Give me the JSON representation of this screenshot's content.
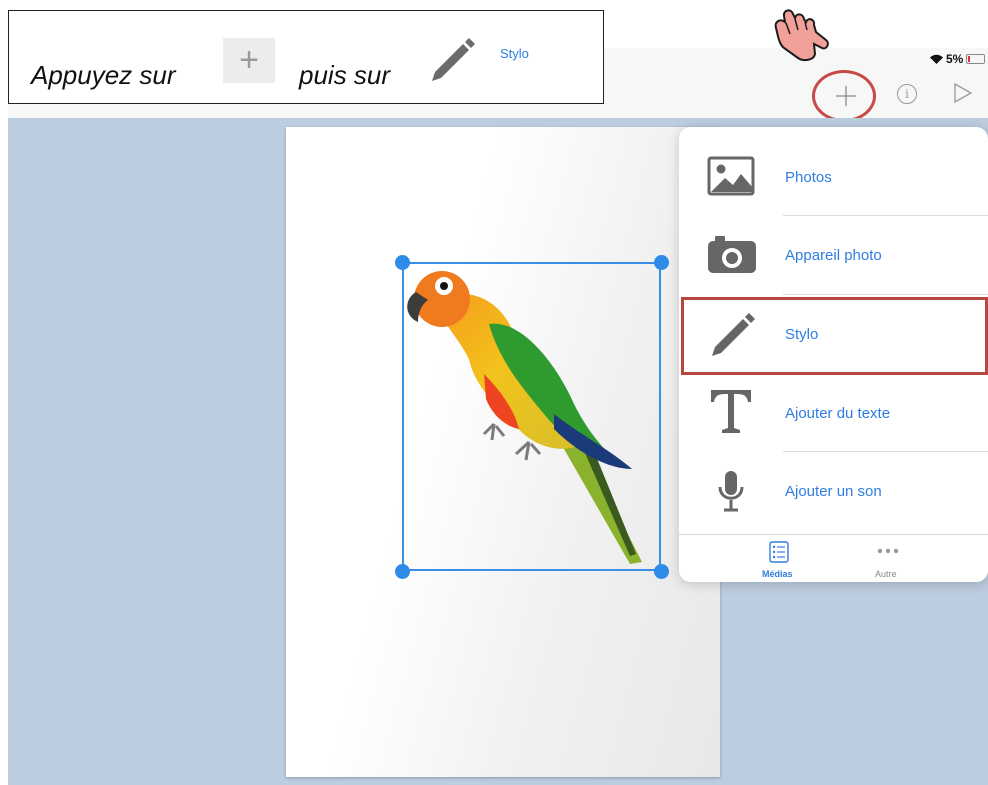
{
  "instruction": {
    "text_before": "Appuyez sur",
    "plus_symbol": "+",
    "text_middle": "puis sur",
    "stylo_label": "Stylo"
  },
  "status_bar": {
    "battery_percent": "5%"
  },
  "toolbar": {
    "add_icon": "plus-icon",
    "info_icon": "info-icon",
    "play_icon": "play-icon",
    "info_glyph": "i"
  },
  "media_menu": {
    "items": [
      {
        "label": "Photos",
        "icon": "photos-icon"
      },
      {
        "label": "Appareil photo",
        "icon": "camera-icon"
      },
      {
        "label": "Stylo",
        "icon": "pencil-icon"
      },
      {
        "label": "Ajouter du texte",
        "icon": "text-icon"
      },
      {
        "label": "Ajouter un son",
        "icon": "microphone-icon"
      }
    ],
    "tabs": [
      {
        "label": "Médias",
        "icon": "list-icon",
        "active": true
      },
      {
        "label": "Autre",
        "icon": "more-icon",
        "active": false
      }
    ]
  },
  "colors": {
    "accent": "#2f7de1",
    "highlight": "#b5473f",
    "workspace": "#bccddf",
    "selection": "#3b8ee8"
  }
}
